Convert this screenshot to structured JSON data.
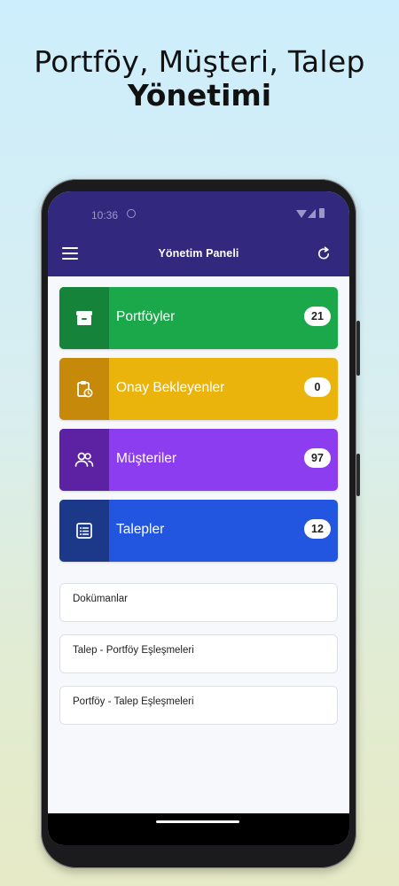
{
  "promo": {
    "line1": "Portföy, Müşteri, Talep",
    "line2": "Yönetimi"
  },
  "status_bar": {
    "time": "10:36"
  },
  "appbar": {
    "title": "Yönetim Paneli",
    "left_icon": "menu-icon",
    "right_icon": "refresh-icon"
  },
  "cards": [
    {
      "label": "Portföyler",
      "count": "21",
      "icon": "archive-box-icon",
      "color": "#1aa84a",
      "icon_bg": "#16833b"
    },
    {
      "label": "Onay Bekleyenler",
      "count": "0",
      "icon": "clipboard-clock-icon",
      "color": "#ebb40c",
      "icon_bg": "#c6890a"
    },
    {
      "label": "Müşteriler",
      "count": "97",
      "icon": "users-icon",
      "color": "#8d3df0",
      "icon_bg": "#5d21a4"
    },
    {
      "label": "Talepler",
      "count": "12",
      "icon": "list-icon",
      "color": "#2356e0",
      "icon_bg": "#1c3888"
    }
  ],
  "links": [
    {
      "label": "Dokümanlar"
    },
    {
      "label": "Talep - Portföy Eşleşmeleri"
    },
    {
      "label": "Portföy - Talep Eşleşmeleri"
    }
  ]
}
